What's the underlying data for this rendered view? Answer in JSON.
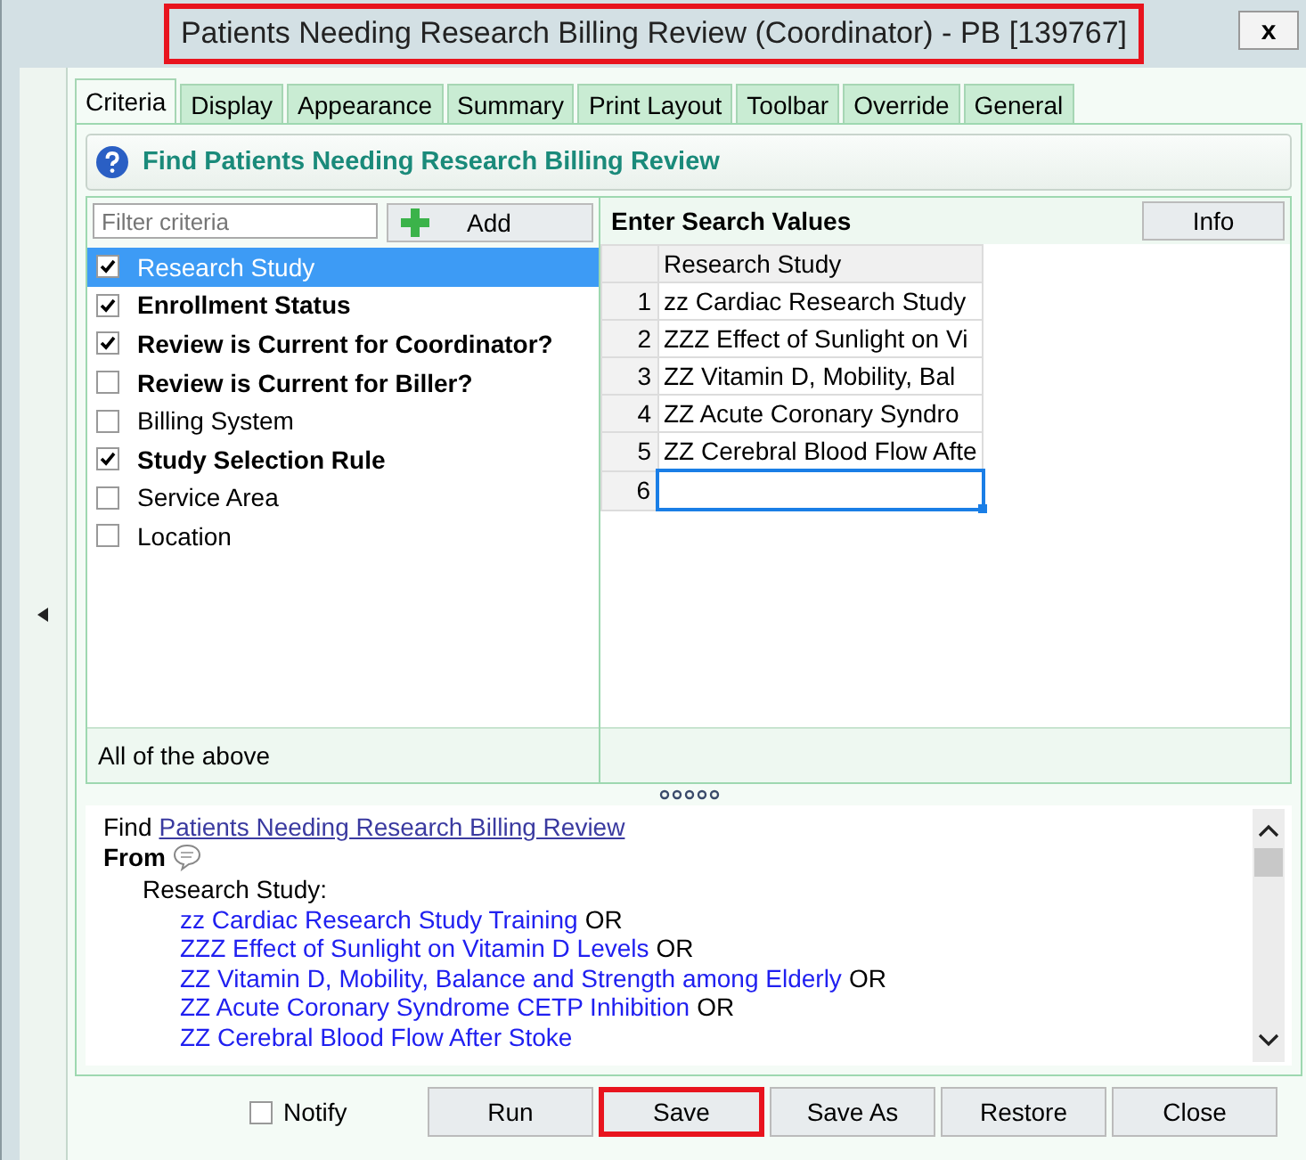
{
  "window": {
    "title": "Patients Needing Research Billing Review (Coordinator) - PB [139767]",
    "title_highlighted": true,
    "close": "x"
  },
  "tabs": [
    {
      "label": "Criteria",
      "selected": true
    },
    {
      "label": "Display",
      "selected": false
    },
    {
      "label": "Appearance",
      "selected": false
    },
    {
      "label": "Summary",
      "selected": false
    },
    {
      "label": "Print Layout",
      "selected": false
    },
    {
      "label": "Toolbar",
      "selected": false
    },
    {
      "label": "Override",
      "selected": false
    },
    {
      "label": "General",
      "selected": false
    }
  ],
  "section_title": "Find Patients Needing Research Billing Review",
  "criteria": {
    "filter_placeholder": "Filter criteria",
    "add_button": "Add",
    "items": [
      {
        "label": "Research Study",
        "checked": true,
        "bold": false,
        "selected": true
      },
      {
        "label": "Enrollment Status",
        "checked": true,
        "bold": true,
        "selected": false
      },
      {
        "label": "Review is Current for Coordinator?",
        "checked": true,
        "bold": true,
        "selected": false
      },
      {
        "label": "Review is Current for Biller?",
        "checked": false,
        "bold": true,
        "selected": false
      },
      {
        "label": "Billing System",
        "checked": false,
        "bold": false,
        "selected": false
      },
      {
        "label": "Study Selection Rule",
        "checked": true,
        "bold": true,
        "selected": false
      },
      {
        "label": "Service Area",
        "checked": false,
        "bold": false,
        "selected": false
      },
      {
        "label": "Location",
        "checked": false,
        "bold": false,
        "selected": false
      }
    ],
    "footer": "All of the above"
  },
  "search_values": {
    "title": "Enter Search Values",
    "info_button": "Info",
    "column": "Research Study",
    "rows": [
      {
        "number": "1",
        "value": "zz Cardiac Research Study",
        "selected": false
      },
      {
        "number": "2",
        "value": "ZZZ Effect of Sunlight on Vi",
        "selected": false
      },
      {
        "number": "3",
        "value": "ZZ Vitamin D, Mobility, Bal",
        "selected": false
      },
      {
        "number": "4",
        "value": "ZZ Acute Coronary Syndro",
        "selected": false
      },
      {
        "number": "5",
        "value": "ZZ Cerebral Blood Flow Afte",
        "selected": false
      },
      {
        "number": "6",
        "value": "",
        "selected": true
      }
    ]
  },
  "summary": {
    "find_label": "Find",
    "find_link": "Patients Needing Research Billing Review",
    "from_label": "From",
    "heading": "Research Study:",
    "values": [
      {
        "text": "zz Cardiac Research Study Training",
        "connector": "OR"
      },
      {
        "text": "ZZZ Effect of Sunlight on Vitamin D Levels",
        "connector": "OR"
      },
      {
        "text": "ZZ Vitamin D, Mobility, Balance and Strength among Elderly",
        "connector": "OR"
      },
      {
        "text": "ZZ Acute Coronary Syndrome CETP Inhibition",
        "connector": "OR"
      },
      {
        "text": "ZZ Cerebral Blood Flow After Stoke"
      }
    ]
  },
  "footer": {
    "notify": {
      "label": "Notify",
      "checked": false
    },
    "buttons": [
      {
        "label": "Run",
        "highlighted": false
      },
      {
        "label": "Save",
        "highlighted": true
      },
      {
        "label": "Save As",
        "highlighted": false
      },
      {
        "label": "Restore",
        "highlighted": false
      },
      {
        "label": "Close",
        "highlighted": false
      }
    ]
  }
}
